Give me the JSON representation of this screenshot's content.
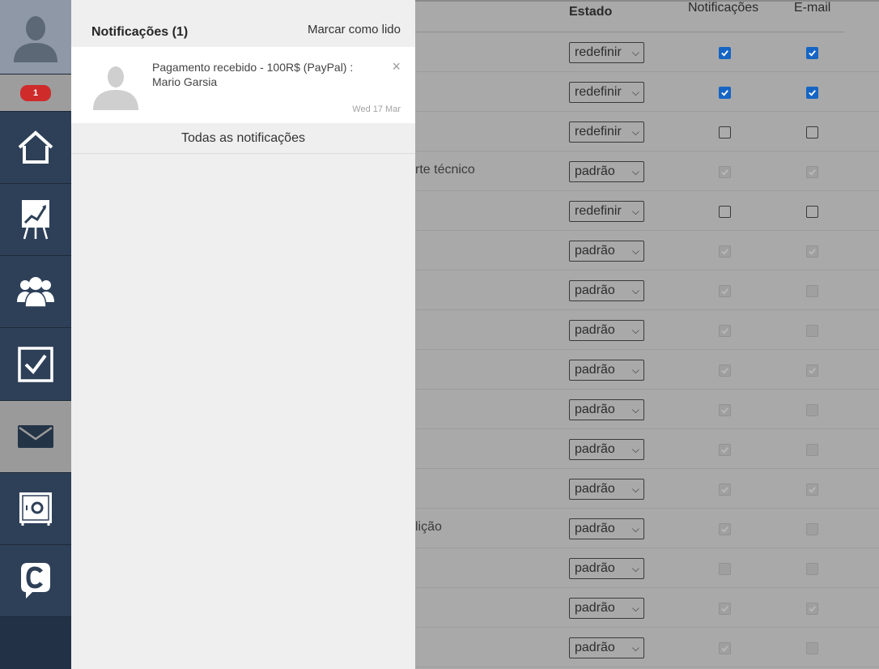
{
  "sidebar": {
    "badge_count": "1",
    "items": [
      {
        "icon": "home-icon",
        "label": "home"
      },
      {
        "icon": "chart-icon",
        "label": "statistics"
      },
      {
        "icon": "users-icon",
        "label": "users"
      },
      {
        "icon": "checkbox-icon",
        "label": "tasks"
      },
      {
        "icon": "mail-icon",
        "label": "messages",
        "active": true
      },
      {
        "icon": "safe-icon",
        "label": "vault"
      },
      {
        "icon": "chat-c-icon",
        "label": "chat"
      }
    ]
  },
  "panel": {
    "title": "Notificações (1)",
    "mark_read": "Marcar como lido",
    "notification": {
      "text": "Pagamento recebido - 100R$ (PayPal) : Mario Garsia",
      "date": "Wed 17 Mar",
      "close": "×"
    },
    "all_label": "Todas as notificações"
  },
  "table": {
    "headers": {
      "state": "Estado",
      "notifications": "Notificações",
      "email": "E-mail"
    },
    "rows": [
      {
        "text": "",
        "state": "redefinir",
        "notif": "on",
        "email": "on"
      },
      {
        "text": "",
        "state": "redefinir",
        "notif": "on",
        "email": "on"
      },
      {
        "text": "",
        "state": "redefinir",
        "notif": "off",
        "email": "off"
      },
      {
        "text": "rte técnico",
        "state": "padrão",
        "notif": "dis",
        "email": "dis"
      },
      {
        "text": "",
        "state": "redefinir",
        "notif": "off",
        "email": "off"
      },
      {
        "text": "",
        "state": "padrão",
        "notif": "dis",
        "email": "dis"
      },
      {
        "text": "",
        "state": "padrão",
        "notif": "dis",
        "email": "dis-empty"
      },
      {
        "text": "",
        "state": "padrão",
        "notif": "dis",
        "email": "dis-empty"
      },
      {
        "text": "",
        "state": "padrão",
        "notif": "dis",
        "email": "dis"
      },
      {
        "text": "",
        "state": "padrão",
        "notif": "dis",
        "email": "dis-empty"
      },
      {
        "text": "",
        "state": "padrão",
        "notif": "dis",
        "email": "dis-empty"
      },
      {
        "text": "",
        "state": "padrão",
        "notif": "dis",
        "email": "dis"
      },
      {
        "text": " lição",
        "state": "padrão",
        "notif": "dis",
        "email": "dis-empty"
      },
      {
        "text": "",
        "state": "padrão",
        "notif": "dis-empty",
        "email": "dis-empty"
      },
      {
        "text": "",
        "state": "padrão",
        "notif": "dis",
        "email": "dis"
      },
      {
        "text": "",
        "state": "padrão",
        "notif": "dis",
        "email": "dis-empty"
      }
    ]
  },
  "colors": {
    "sidebar_bg": "#2e4058",
    "badge": "#cf2b2b",
    "checkbox_on": "#1665c4"
  }
}
